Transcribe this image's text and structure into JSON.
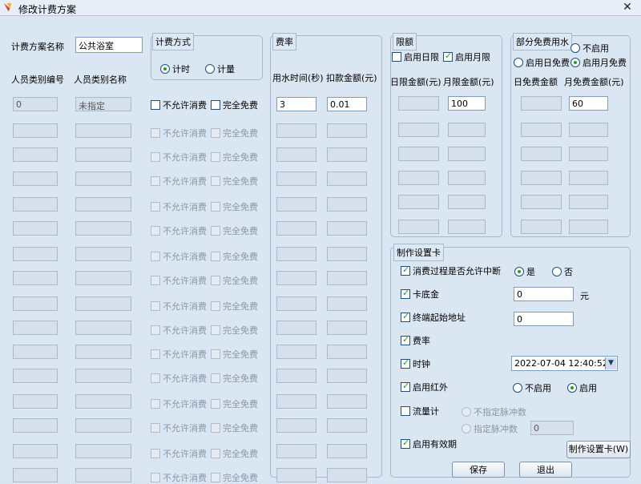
{
  "window": {
    "title": "修改计费方案",
    "close_glyph": "✕"
  },
  "scheme": {
    "name_label": "计费方案名称",
    "name_value": "公共浴室"
  },
  "billing_method": {
    "title": "计费方式",
    "by_time": "计时",
    "by_volume": "计量",
    "selected": "计时"
  },
  "people": {
    "col_id": "人员类别编号",
    "col_name": "人员类别名称",
    "first_row": {
      "id": "0",
      "name": "未指定"
    }
  },
  "options": {
    "no_consume": "不允许消费",
    "full_free": "完全免费"
  },
  "rate": {
    "title": "费率",
    "col_time": "用水时间(秒)",
    "col_amount": "扣款金额(元)",
    "first_row": {
      "time": "3",
      "amount": "0.01"
    }
  },
  "limit": {
    "title": "限额",
    "enable_daily": "启用日限",
    "enable_monthly": "启用月限",
    "daily_checked": false,
    "monthly_checked": true,
    "col_daily": "日限金额(元)",
    "col_monthly": "月限金额(元)",
    "monthly_first": "100"
  },
  "free_water": {
    "title": "部分免费用水",
    "disable": "不启用",
    "enable_daily": "启用日免费",
    "enable_monthly": "启用月免费",
    "selected": "启用月免费",
    "col_daily": "日免费金额",
    "col_monthly": "月免费金额(元)",
    "monthly_first": "60"
  },
  "card": {
    "title": "制作设置卡",
    "interrupt_label": "消费过程是否允许中断",
    "yes": "是",
    "no": "否",
    "interrupt_selected": "是",
    "base_label": "卡底金",
    "base_value": "0",
    "base_unit": "元",
    "terminal_label": "终端起始地址",
    "terminal_value": "0",
    "rate_label": "费率",
    "clock_label": "时钟",
    "clock_value": "2022-07-04 12:40:52",
    "ir_label": "启用红外",
    "ir_disable": "不启用",
    "ir_enable": "启用",
    "ir_selected": "启用",
    "flow_label": "流量计",
    "flow_unspecified": "不指定脉冲数",
    "flow_specified": "指定脉冲数",
    "flow_value": "0",
    "validity_label": "启用有效期",
    "make_button": "制作设置卡(W)"
  },
  "buttons": {
    "save": "保存",
    "exit": "退出"
  }
}
